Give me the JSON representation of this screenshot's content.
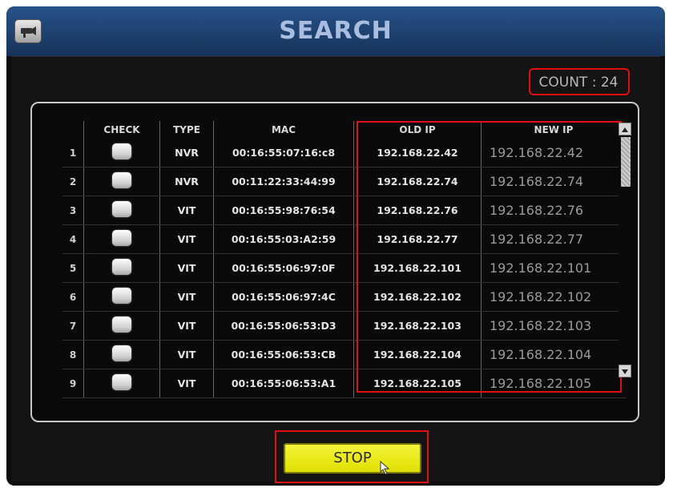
{
  "window": {
    "title": "SEARCH",
    "count_label": "COUNT : 24"
  },
  "table": {
    "headers": {
      "check": "CHECK",
      "type": "TYPE",
      "mac": "MAC",
      "old_ip": "OLD IP",
      "new_ip": "NEW IP"
    },
    "rows": [
      {
        "index": "1",
        "type": "NVR",
        "mac": "00:16:55:07:16:c8",
        "old_ip": "192.168.22.42",
        "new_ip": "192.168.22.42"
      },
      {
        "index": "2",
        "type": "NVR",
        "mac": "00:11:22:33:44:99",
        "old_ip": "192.168.22.74",
        "new_ip": "192.168.22.74"
      },
      {
        "index": "3",
        "type": "VIT",
        "mac": "00:16:55:98:76:54",
        "old_ip": "192.168.22.76",
        "new_ip": "192.168.22.76"
      },
      {
        "index": "4",
        "type": "VIT",
        "mac": "00:16:55:03:A2:59",
        "old_ip": "192.168.22.77",
        "new_ip": "192.168.22.77"
      },
      {
        "index": "5",
        "type": "VIT",
        "mac": "00:16:55:06:97:0F",
        "old_ip": "192.168.22.101",
        "new_ip": "192.168.22.101"
      },
      {
        "index": "6",
        "type": "VIT",
        "mac": "00:16:55:06:97:4C",
        "old_ip": "192.168.22.102",
        "new_ip": "192.168.22.102"
      },
      {
        "index": "7",
        "type": "VIT",
        "mac": "00:16:55:06:53:D3",
        "old_ip": "192.168.22.103",
        "new_ip": "192.168.22.103"
      },
      {
        "index": "8",
        "type": "VIT",
        "mac": "00:16:55:06:53:CB",
        "old_ip": "192.168.22.104",
        "new_ip": "192.168.22.104"
      },
      {
        "index": "9",
        "type": "VIT",
        "mac": "00:16:55:06:53:A1",
        "old_ip": "192.168.22.105",
        "new_ip": "192.168.22.105"
      }
    ]
  },
  "buttons": {
    "stop_label": "STOP"
  },
  "icons": {
    "camera": "camera-icon",
    "scroll_up": "scroll-up-icon",
    "scroll_down": "scroll-down-icon",
    "cursor": "mouse-cursor-icon"
  },
  "colors": {
    "title_bar": "#1d3f6c",
    "title_text": "#a9bde0",
    "highlight": "#e01010",
    "stop_button": "#eeee22"
  }
}
